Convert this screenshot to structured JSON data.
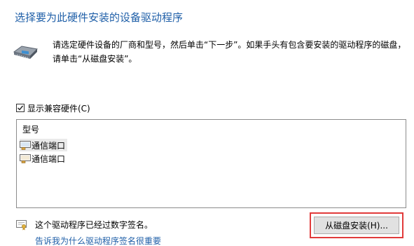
{
  "header": {
    "title": "选择要为此硬件安装的设备驱动程序",
    "hardware_icon": "hardware-card-icon"
  },
  "instructions": {
    "line1": "请选定硬件设备的厂商和型号，然后单击“下一步”。如果手头有包含要安装的驱动程序的磁盘，",
    "line2": "请单击“从磁盘安装”。"
  },
  "compatible": {
    "label": "显示兼容硬件(C)",
    "checked": true
  },
  "model_list": {
    "header": "型号",
    "item_icon": "port-icon",
    "items": [
      {
        "label": "通信端口",
        "selected": true
      },
      {
        "label": "通信端口",
        "selected": false
      }
    ]
  },
  "footer": {
    "signed_icon": "certificate-icon",
    "signed_text": "这个驱动程序已经过数字签名。",
    "have_disk_button": "从磁盘安装(H)...",
    "signing_link": "告诉我为什么驱动程序签名很重要"
  },
  "colors": {
    "title": "#1f5fa8",
    "highlight_border": "#e13b3b"
  }
}
